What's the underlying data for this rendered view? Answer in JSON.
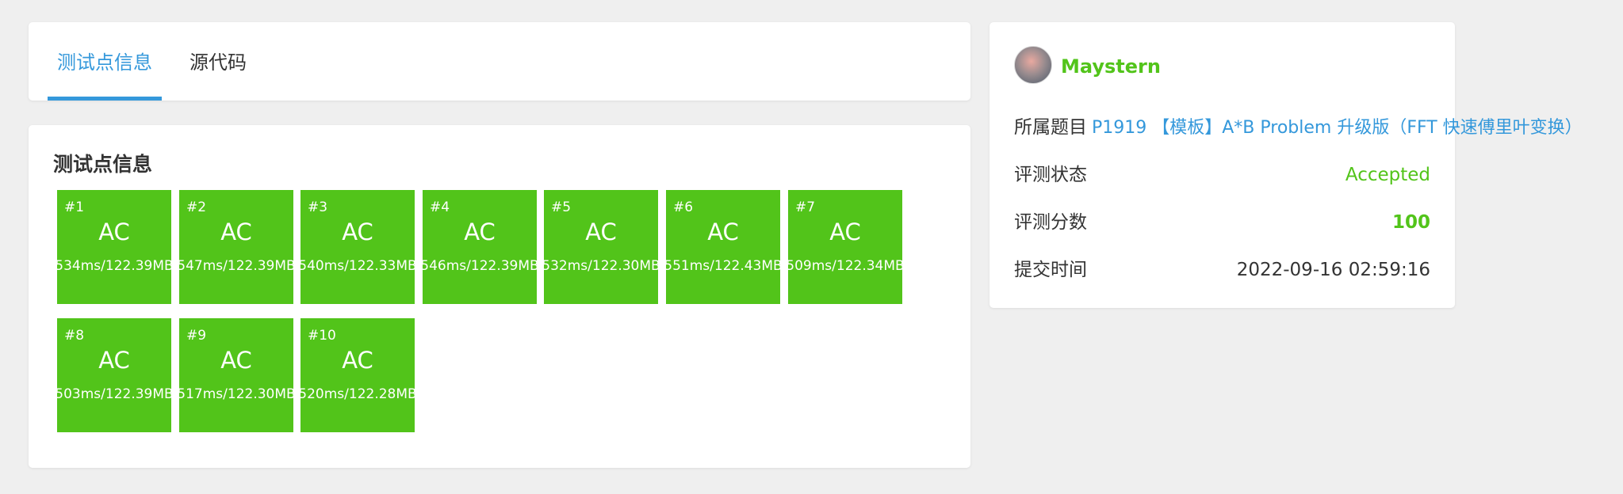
{
  "tabs": [
    {
      "label": "测试点信息",
      "active": true
    },
    {
      "label": "源代码",
      "active": false
    }
  ],
  "cases_section": {
    "title": "测试点信息",
    "cases": [
      {
        "id": "#1",
        "status": "AC",
        "detail": "534ms/122.39MB"
      },
      {
        "id": "#2",
        "status": "AC",
        "detail": "547ms/122.39MB"
      },
      {
        "id": "#3",
        "status": "AC",
        "detail": "540ms/122.33MB"
      },
      {
        "id": "#4",
        "status": "AC",
        "detail": "546ms/122.39MB"
      },
      {
        "id": "#5",
        "status": "AC",
        "detail": "532ms/122.30MB"
      },
      {
        "id": "#6",
        "status": "AC",
        "detail": "551ms/122.43MB"
      },
      {
        "id": "#7",
        "status": "AC",
        "detail": "509ms/122.34MB"
      },
      {
        "id": "#8",
        "status": "AC",
        "detail": "503ms/122.39MB"
      },
      {
        "id": "#9",
        "status": "AC",
        "detail": "517ms/122.30MB"
      },
      {
        "id": "#10",
        "status": "AC",
        "detail": "520ms/122.28MB"
      }
    ]
  },
  "info": {
    "username": "Maystern",
    "problem_label": "所属题目",
    "problem_link": "P1919 【模板】A*B Problem 升级版（FFT 快速傅里叶变换）",
    "status_label": "评测状态",
    "status_value": "Accepted",
    "score_label": "评测分数",
    "score_value": "100",
    "time_label": "提交时间",
    "time_value": "2022-09-16 02:59:16"
  },
  "colors": {
    "accent": "#3498db",
    "ac_green": "#52c41a",
    "background": "#efefef"
  }
}
